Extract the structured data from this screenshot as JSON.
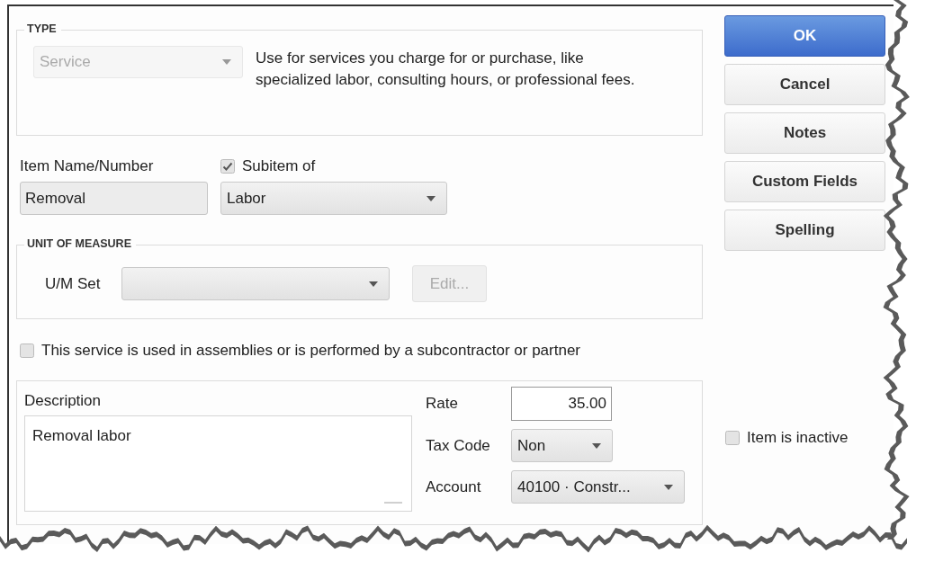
{
  "type_section": {
    "legend": "TYPE",
    "type_dropdown": {
      "value": "Service",
      "disabled": true
    },
    "description": "Use for services you charge for or purchase, like specialized labor, consulting hours, or professional fees."
  },
  "item_name": {
    "label": "Item Name/Number",
    "value": "Removal"
  },
  "subitem": {
    "label": "Subitem of",
    "checked": true,
    "value": "Labor"
  },
  "unit_of_measure": {
    "legend": "UNIT OF MEASURE",
    "label": "U/M Set",
    "edit_button": {
      "label": "Edit...",
      "disabled": true
    }
  },
  "assemblies_checkbox": {
    "label": "This service is used in assemblies or is performed by a subcontractor or partner",
    "checked": false
  },
  "description": {
    "label": "Description",
    "value": "Removal labor"
  },
  "rate": {
    "label": "Rate",
    "value": "35.00"
  },
  "tax_code": {
    "label": "Tax Code",
    "value": "Non"
  },
  "account": {
    "label": "Account",
    "value": "40100 · Constr..."
  },
  "buttons": [
    {
      "label": "OK",
      "kind": "primary"
    },
    {
      "label": "Cancel",
      "kind": "normal"
    },
    {
      "label": "Notes",
      "kind": "normal"
    },
    {
      "label": "Custom Fields",
      "kind": "normal"
    },
    {
      "label": "Spelling",
      "kind": "normal"
    }
  ],
  "inactive_checkbox": {
    "label": "Item is inactive",
    "checked": false
  }
}
